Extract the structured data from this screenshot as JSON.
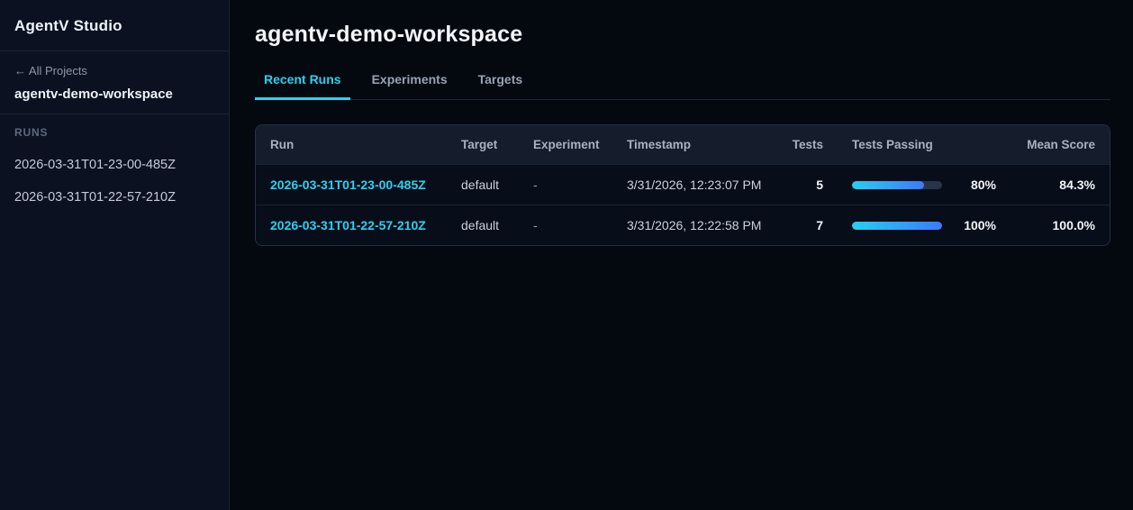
{
  "app": {
    "title": "AgentV Studio"
  },
  "sidebar": {
    "back_arrow": "←",
    "back_label": "All Projects",
    "workspace_name": "agentv-demo-workspace",
    "runs_heading": "RUNS",
    "runs": [
      "2026-03-31T01-23-00-485Z",
      "2026-03-31T01-22-57-210Z"
    ]
  },
  "main": {
    "title": "agentv-demo-workspace",
    "tabs": [
      {
        "label": "Recent Runs",
        "active": true
      },
      {
        "label": "Experiments",
        "active": false
      },
      {
        "label": "Targets",
        "active": false
      }
    ],
    "table": {
      "columns": [
        "Run",
        "Target",
        "Experiment",
        "Timestamp",
        "Tests",
        "Tests Passing",
        "Mean Score"
      ],
      "rows": [
        {
          "run": "2026-03-31T01-23-00-485Z",
          "target": "default",
          "experiment": "-",
          "timestamp": "3/31/2026, 12:23:07 PM",
          "tests": "5",
          "passing_pct": 80,
          "passing_label": "80%",
          "mean_score": "84.3%"
        },
        {
          "run": "2026-03-31T01-22-57-210Z",
          "target": "default",
          "experiment": "-",
          "timestamp": "3/31/2026, 12:22:58 PM",
          "tests": "7",
          "passing_pct": 100,
          "passing_label": "100%",
          "mean_score": "100.0%"
        }
      ]
    }
  },
  "colors": {
    "accent_cyan": "#29d3f2",
    "accent_blue": "#3a7bfa",
    "sidebar_bg": "#0b1120",
    "main_bg": "#04080f"
  }
}
